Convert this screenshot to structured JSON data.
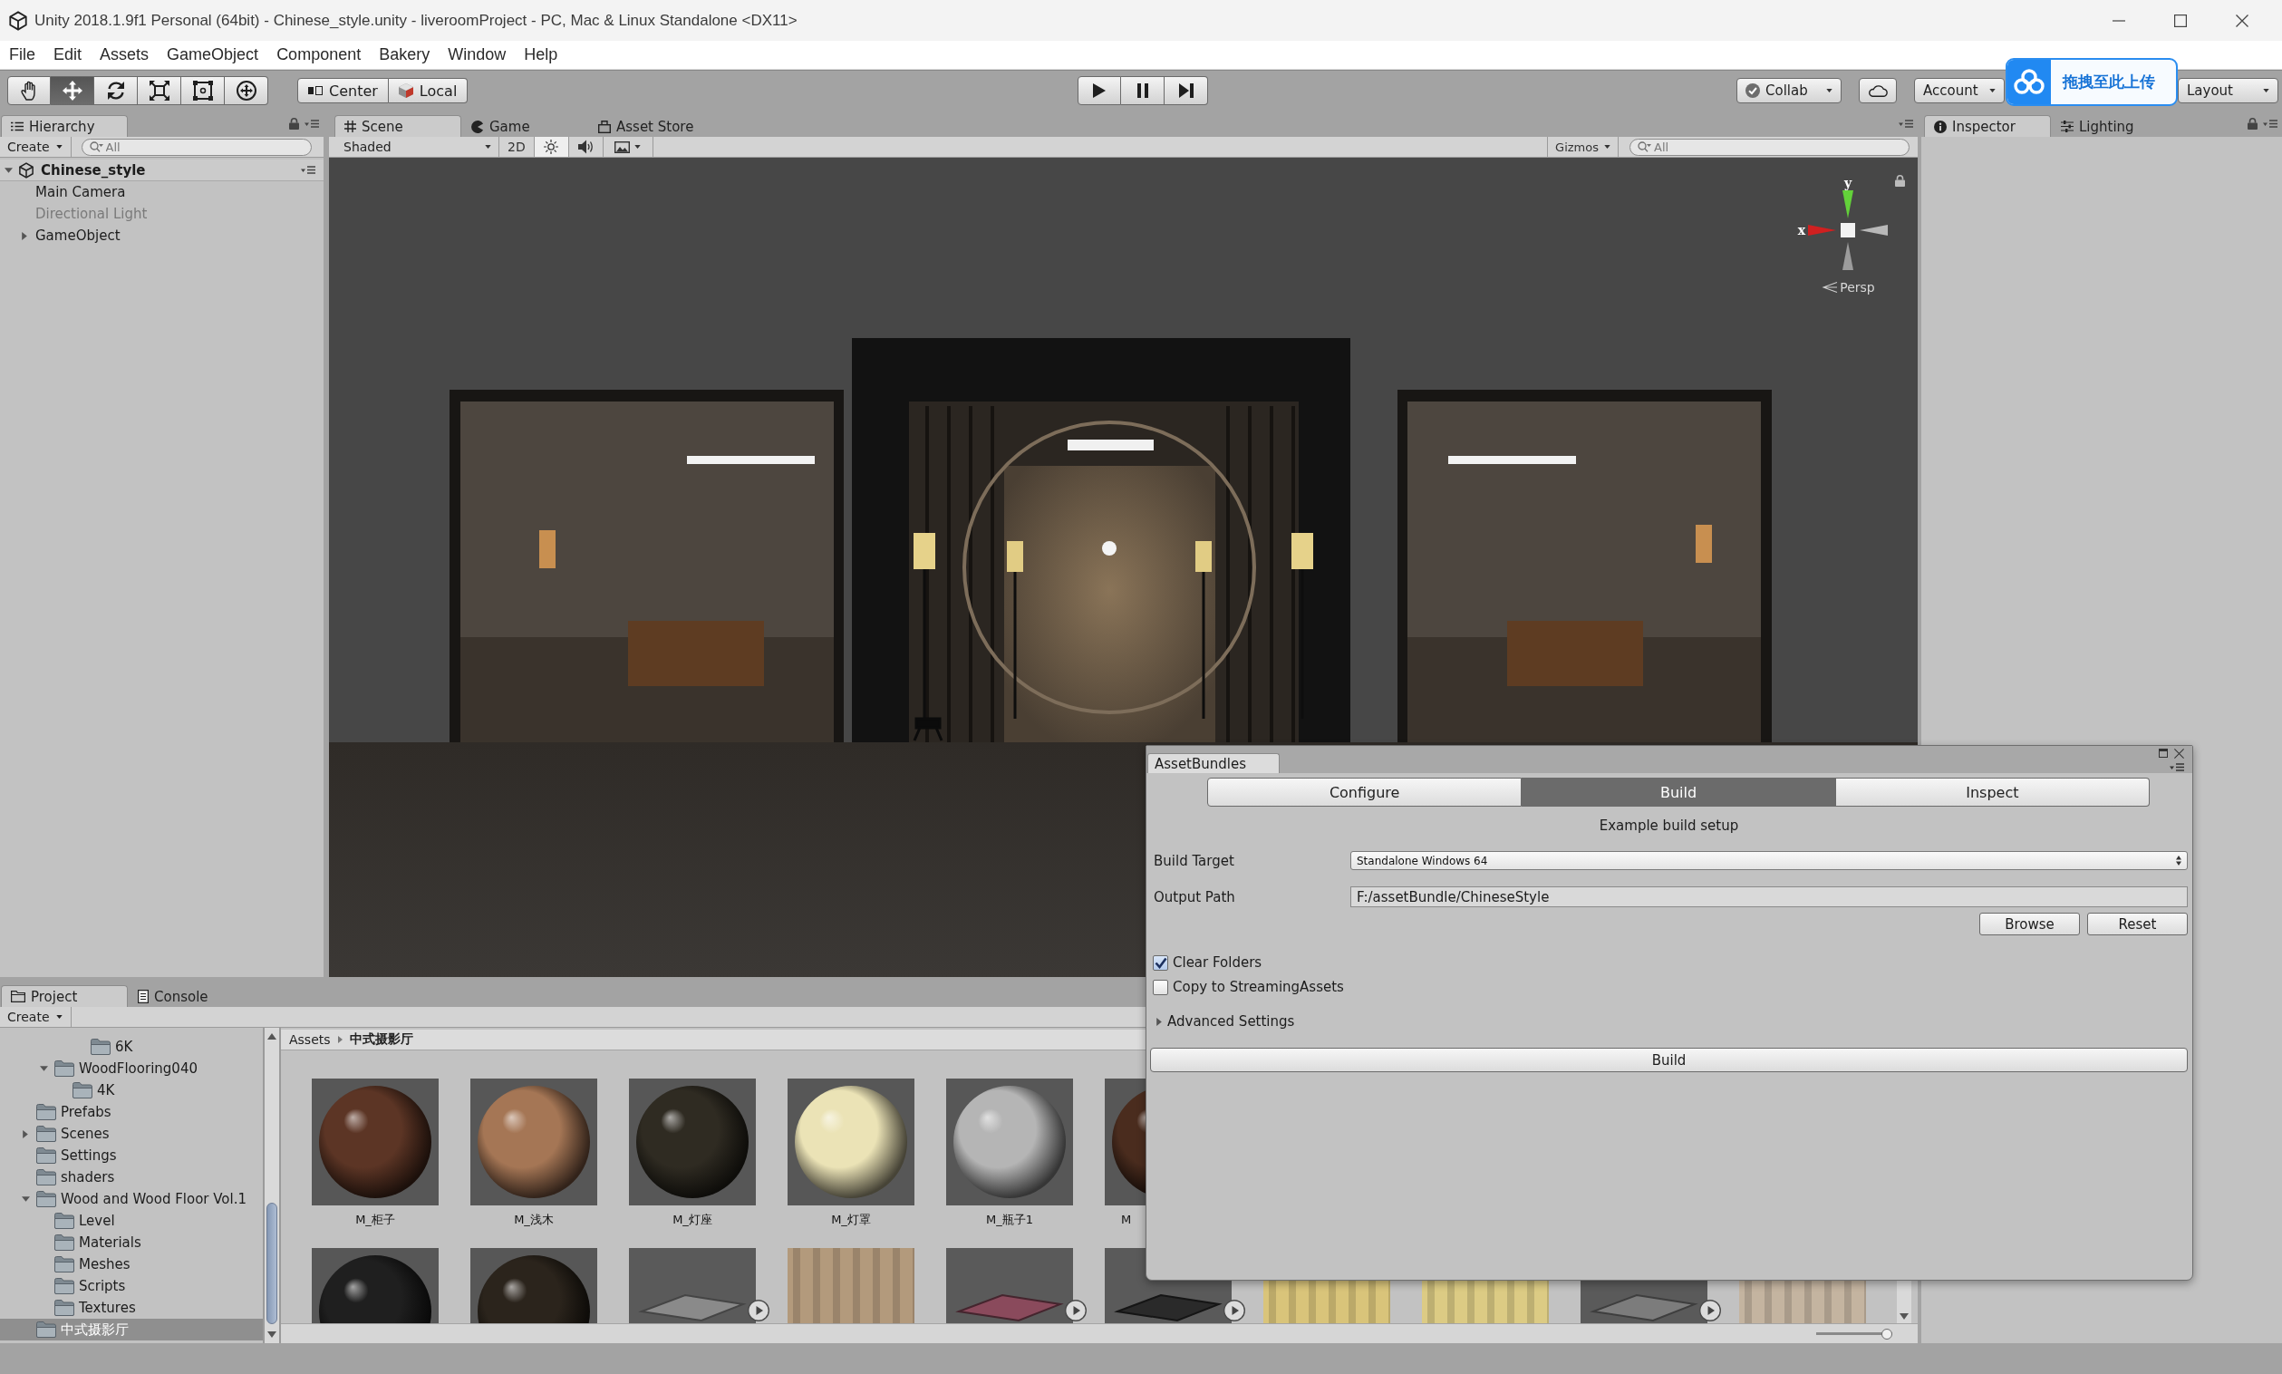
{
  "window": {
    "title": "Unity 2018.1.9f1 Personal (64bit) - Chinese_style.unity - liveroomProject - PC, Mac & Linux Standalone <DX11>"
  },
  "menu": [
    "File",
    "Edit",
    "Assets",
    "GameObject",
    "Component",
    "Bakery",
    "Window",
    "Help"
  ],
  "toolbar": {
    "tools": [
      {
        "kind": "hand",
        "selected": false
      },
      {
        "kind": "move",
        "selected": true
      },
      {
        "kind": "rotate",
        "selected": false
      },
      {
        "kind": "scale",
        "selected": false
      },
      {
        "kind": "rect",
        "selected": false
      },
      {
        "kind": "transform",
        "selected": false
      }
    ],
    "pivot": [
      {
        "kind": "center",
        "label": "Center"
      },
      {
        "kind": "local",
        "label": "Local"
      }
    ],
    "playback": [
      {
        "kind": "play"
      },
      {
        "kind": "pause"
      },
      {
        "kind": "step"
      }
    ],
    "collab": "Collab",
    "account": "Account",
    "layout": "Layout"
  },
  "upload_widget": {
    "label": "拖拽至此上传"
  },
  "hierarchy": {
    "tabs": [
      {
        "label": "Hierarchy",
        "kind": "hierarchy",
        "selected": true
      }
    ],
    "create": "Create",
    "search_placeholder": "All",
    "scene": {
      "label": "Chinese_style",
      "expanded": true,
      "children": [
        {
          "label": "Main Camera",
          "active": true,
          "has_children": false,
          "expanded": false
        },
        {
          "label": "Directional Light",
          "active": false,
          "has_children": false,
          "expanded": false
        },
        {
          "label": "GameObject",
          "active": true,
          "has_children": true,
          "expanded": false
        }
      ]
    }
  },
  "scene_panel": {
    "tabs": [
      {
        "label": "Scene",
        "kind": "scene",
        "selected": true
      },
      {
        "label": "Game",
        "kind": "game",
        "selected": false
      },
      {
        "label": "Asset Store",
        "kind": "store",
        "selected": false
      }
    ],
    "shading": "Shaded",
    "toggles": [
      {
        "kind": "dimension",
        "label": "2D",
        "on": false
      },
      {
        "kind": "lighting",
        "on": true
      },
      {
        "kind": "audio",
        "on": false
      },
      {
        "kind": "effects",
        "on": false
      }
    ],
    "gizmos": "Gizmos",
    "search_placeholder": "All",
    "axis_labels": {
      "x": "x",
      "y": "y"
    },
    "projection": "Persp"
  },
  "inspector_panel": {
    "tabs": [
      {
        "label": "Inspector",
        "kind": "inspector",
        "selected": true
      },
      {
        "label": "Lighting",
        "kind": "lighting",
        "selected": false
      }
    ]
  },
  "project_panel": {
    "tabs": [
      {
        "label": "Project",
        "kind": "project",
        "selected": true
      },
      {
        "label": "Console",
        "kind": "console",
        "selected": false
      }
    ],
    "create": "Create",
    "tree": [
      {
        "children": [
          {
            "children": [
              {
                "children": [
                  {
                    "label": "6K",
                    "selected": false,
                    "has_children": false,
                    "expanded": false
                  }
                ]
              }
            ]
          },
          {
            "label": "WoodFlooring040",
            "selected": false,
            "has_children": true,
            "expanded": true,
            "children": [
              {
                "label": "4K",
                "selected": false,
                "has_children": false,
                "expanded": false
              }
            ]
          }
        ]
      },
      {
        "label": "Prefabs",
        "selected": false,
        "has_children": false,
        "expanded": false
      },
      {
        "label": "Scenes",
        "selected": false,
        "has_children": true,
        "expanded": false
      },
      {
        "label": "Settings",
        "selected": false,
        "has_children": false,
        "expanded": false
      },
      {
        "label": "shaders",
        "selected": false,
        "has_children": false,
        "expanded": false
      },
      {
        "label": "Wood and Wood Floor Vol.1",
        "selected": false,
        "has_children": true,
        "expanded": true,
        "children": [
          {
            "label": "Level",
            "selected": false,
            "has_children": false,
            "expanded": false
          },
          {
            "label": "Materials",
            "selected": false,
            "has_children": false,
            "expanded": false
          },
          {
            "label": "Meshes",
            "selected": false,
            "has_children": false,
            "expanded": false
          },
          {
            "label": "Scripts",
            "selected": false,
            "has_children": false,
            "expanded": false
          },
          {
            "label": "Textures",
            "selected": false,
            "has_children": false,
            "expanded": false
          }
        ]
      },
      {
        "label": "中式摄影厅",
        "selected": true,
        "has_children": false,
        "expanded": false
      }
    ],
    "breadcrumb": [
      "Assets",
      "中式摄影厅"
    ],
    "asset_rows": [
      [
        {
          "kind": "material",
          "color": "#5c3525",
          "label": "M_柜子"
        },
        {
          "kind": "material",
          "color": "#a57655",
          "label": "M_浅木"
        },
        {
          "kind": "material",
          "color": "#2f2b22",
          "label": "M_灯座"
        },
        {
          "kind": "material",
          "color": "#ebe3b6",
          "label": "M_灯罩"
        },
        {
          "kind": "material",
          "color": "#b5b5b5",
          "label": "M_瓶子1"
        },
        {
          "kind": "material",
          "color": "#4a2c1e",
          "label": "M"
        }
      ],
      [
        {
          "kind": "material",
          "color": "#1f1f1f"
        },
        {
          "kind": "material",
          "color": "#2b241c"
        },
        {
          "kind": "model",
          "color": "#8a8a8a"
        },
        {
          "kind": "texture",
          "color": "#b39a7c"
        },
        {
          "kind": "model",
          "color": "#8a4a5c"
        },
        {
          "kind": "model",
          "color": "#2a2a2a"
        },
        {
          "kind": "texture",
          "color": "#d9c47a"
        },
        {
          "kind": "texture",
          "color": "#dccb84"
        },
        {
          "kind": "model",
          "color": "#7c7c7c"
        },
        {
          "kind": "texture",
          "color": "#c4b4a0"
        }
      ]
    ],
    "size_slider": {
      "level": 0.93
    }
  },
  "asset_bundles": {
    "title": "AssetBundles",
    "tabs": [
      {
        "label": "Configure",
        "selected": false
      },
      {
        "label": "Build",
        "selected": true
      },
      {
        "label": "Inspect",
        "selected": false
      }
    ],
    "heading": "Example build setup",
    "fields": [
      {
        "kind": "dropdown",
        "label": "Build Target",
        "value": "Standalone Windows 64"
      },
      {
        "kind": "text",
        "label": "Output Path",
        "value": "F:/assetBundle/ChineseStyle"
      }
    ],
    "path_buttons": [
      "Browse",
      "Reset"
    ],
    "options": [
      {
        "label": "Clear Folders",
        "checked": true
      },
      {
        "label": "Copy to StreamingAssets",
        "checked": false
      }
    ],
    "advanced": {
      "label": "Advanced Settings",
      "expanded": false
    },
    "build_button": "Build"
  }
}
